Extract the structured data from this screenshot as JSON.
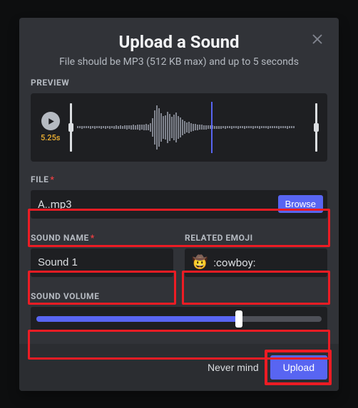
{
  "modal": {
    "title": "Upload a Sound",
    "subtitle": "File should be MP3 (512 KB max) and up to 5 seconds"
  },
  "preview": {
    "label": "PREVIEW",
    "duration": "5.25s",
    "playhead_percent": 57,
    "waveform_heights": [
      3,
      3,
      4,
      3,
      3,
      3,
      4,
      3,
      4,
      3,
      3,
      4,
      3,
      4,
      3,
      4,
      3,
      4,
      5,
      4,
      5,
      4,
      5,
      6,
      5,
      6,
      7,
      6,
      7,
      8,
      7,
      8,
      9,
      8,
      12,
      26,
      48,
      62,
      54,
      40,
      32,
      34,
      44,
      38,
      30,
      36,
      42,
      32,
      28,
      22,
      18,
      14,
      16,
      12,
      10,
      9,
      8,
      7,
      7,
      6,
      6,
      5,
      5,
      5,
      4,
      4,
      4,
      4,
      3,
      4,
      3,
      3,
      4,
      3,
      3,
      4,
      3,
      3,
      4,
      3,
      3,
      3,
      4,
      3,
      3,
      4,
      3,
      3,
      3,
      4,
      3,
      3,
      3,
      3,
      4,
      3,
      3,
      3,
      4,
      3,
      3,
      3
    ]
  },
  "file": {
    "label": "FILE",
    "required": "*",
    "name": "A..mp3",
    "browse_label": "Browse"
  },
  "sound_name": {
    "label": "SOUND NAME",
    "required": "*",
    "value": "Sound 1"
  },
  "emoji": {
    "label": "RELATED EMOJI",
    "icon": "🤠",
    "value": ":cowboy:"
  },
  "volume": {
    "label": "SOUND VOLUME",
    "percent": 71
  },
  "footer": {
    "cancel_label": "Never mind",
    "upload_label": "Upload"
  }
}
